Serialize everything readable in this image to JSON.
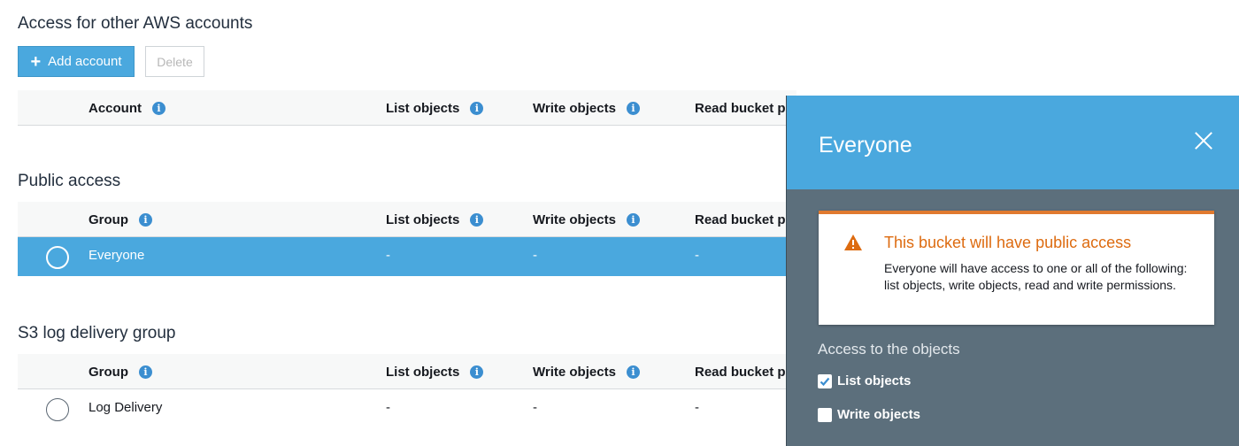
{
  "accounts_section": {
    "title": "Access for other AWS accounts",
    "add_button": "Add account",
    "delete_button": "Delete",
    "columns": [
      "Account",
      "List objects",
      "Write objects",
      "Read bucket p"
    ]
  },
  "public_section": {
    "title": "Public access",
    "columns": [
      "Group",
      "List objects",
      "Write objects",
      "Read bucket p"
    ],
    "row": {
      "name": "Everyone",
      "list": "-",
      "write": "-",
      "read": "-"
    }
  },
  "log_section": {
    "title": "S3 log delivery group",
    "columns": [
      "Group",
      "List objects",
      "Write objects",
      "Read bucket p"
    ],
    "row": {
      "name": "Log Delivery",
      "list": "-",
      "write": "-",
      "read": "-"
    }
  },
  "panel": {
    "title": "Everyone",
    "alert_title": "This bucket will have public access",
    "alert_text": "Everyone will have access to one or all of the following: list objects, write objects, read and write permissions.",
    "subhead": "Access to the objects",
    "checkboxes": [
      {
        "label": "List objects",
        "checked": true
      },
      {
        "label": "Write objects",
        "checked": false
      }
    ]
  },
  "icons": {
    "info": "info-icon",
    "plus": "plus-icon",
    "close": "close-icon",
    "warning": "warning-icon",
    "check": "check-icon"
  },
  "colors": {
    "accent": "#4aa8de",
    "panel_bg": "#5c6f7c",
    "warning": "#dd6b10"
  }
}
